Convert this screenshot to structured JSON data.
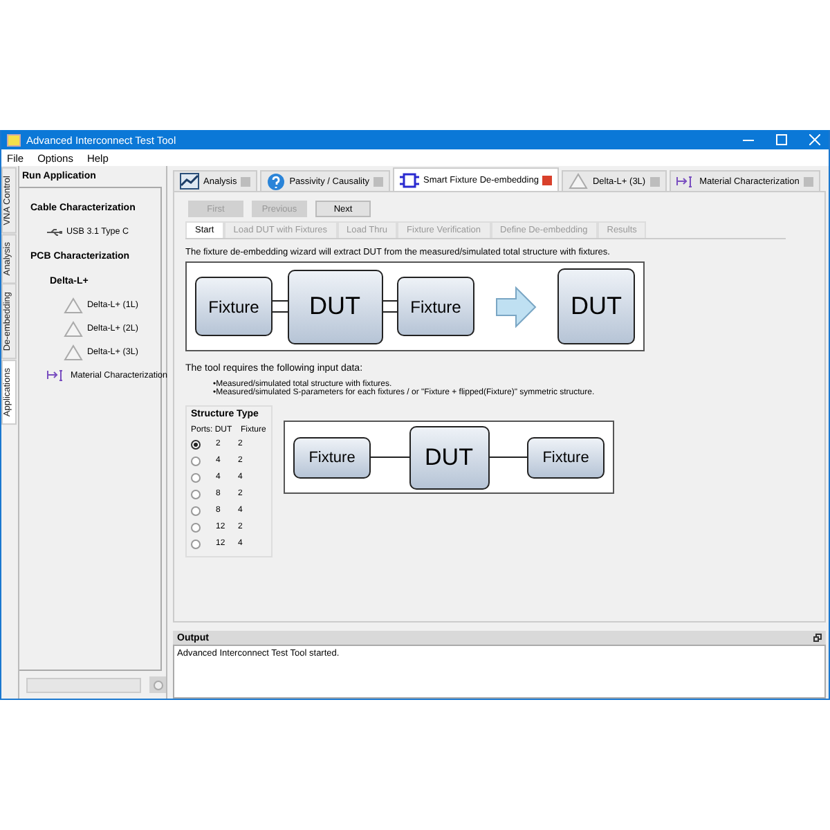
{
  "window": {
    "title": "Advanced Interconnect Test Tool"
  },
  "menu": [
    "File",
    "Options",
    "Help"
  ],
  "side_tabs": [
    {
      "label": "VNA Control",
      "selected": false
    },
    {
      "label": "Analysis",
      "selected": false
    },
    {
      "label": "De-embedding",
      "selected": false
    },
    {
      "label": "Applications",
      "selected": true
    }
  ],
  "sidebar": {
    "title": "Run Application",
    "tree": [
      {
        "label": "Cable Characterization",
        "kind": "group",
        "children": [
          {
            "label": "USB 3.1 Type C",
            "kind": "usb"
          }
        ]
      },
      {
        "label": "PCB Characterization",
        "kind": "group",
        "children": [
          {
            "label": "Delta-L+",
            "kind": "group",
            "children": [
              {
                "label": "Delta-L+ (1L)",
                "kind": "triangle"
              },
              {
                "label": "Delta-L+ (2L)",
                "kind": "triangle"
              },
              {
                "label": "Delta-L+ (3L)",
                "kind": "triangle"
              }
            ]
          },
          {
            "label": "Material Characterization",
            "kind": "material"
          }
        ]
      }
    ]
  },
  "tabs": [
    {
      "label": "Analysis",
      "kind": "analysis",
      "selected": false
    },
    {
      "label": "Passivity / Causality",
      "kind": "question",
      "selected": false
    },
    {
      "label": "Smart Fixture De-embedding",
      "kind": "fixture",
      "selected": true
    },
    {
      "label": "Delta-L+ (3L)",
      "kind": "triangle",
      "selected": false
    },
    {
      "label": "Material Characterization",
      "kind": "material",
      "selected": false
    }
  ],
  "wizard": {
    "nav_buttons": [
      {
        "label": "First",
        "disabled": true
      },
      {
        "label": "Previous",
        "disabled": true
      },
      {
        "label": "Next",
        "disabled": false
      }
    ],
    "steps": [
      {
        "label": "Start",
        "selected": true
      },
      {
        "label": "Load DUT with Fixtures",
        "selected": false
      },
      {
        "label": "Load Thru",
        "selected": false
      },
      {
        "label": "Fixture Verification",
        "selected": false
      },
      {
        "label": "Define De-embedding",
        "selected": false
      },
      {
        "label": "Results",
        "selected": false
      }
    ],
    "intro": "The fixture de-embedding wizard will extract DUT from the measured/simulated total structure with fixtures.",
    "diagram_1": {
      "double_links": true,
      "blocks": [
        {
          "kind": "fixture",
          "label": "Fixture"
        },
        {
          "kind": "dut",
          "label": "DUT"
        },
        {
          "kind": "fixture",
          "label": "Fixture"
        },
        {
          "kind": "arrow"
        },
        {
          "kind": "dut",
          "label": "DUT"
        }
      ]
    },
    "requirements_title": "The tool requires the following input data:",
    "requirements": [
      "•Measured/simulated total structure with fixtures.",
      "•Measured/simulated S-parameters for each fixtures / or \"Fixture + flipped(Fixture)\" symmetric structure."
    ],
    "structure_type": {
      "title": "Structure Type",
      "columns": [
        "Ports: DUT",
        "Fixture"
      ],
      "rows": [
        {
          "dut": "2",
          "fixture": "2",
          "selected": true
        },
        {
          "dut": "4",
          "fixture": "2",
          "selected": false
        },
        {
          "dut": "4",
          "fixture": "4",
          "selected": false
        },
        {
          "dut": "8",
          "fixture": "2",
          "selected": false
        },
        {
          "dut": "8",
          "fixture": "4",
          "selected": false
        },
        {
          "dut": "12",
          "fixture": "2",
          "selected": false
        },
        {
          "dut": "12",
          "fixture": "4",
          "selected": false
        }
      ]
    },
    "diagram_2": {
      "double_links": false,
      "blocks": [
        {
          "kind": "fixture",
          "label": "Fixture"
        },
        {
          "kind": "dut",
          "label": "DUT"
        },
        {
          "kind": "fixture",
          "label": "Fixture"
        }
      ]
    }
  },
  "output": {
    "title": "Output",
    "text": "Advanced Interconnect Test Tool started."
  }
}
